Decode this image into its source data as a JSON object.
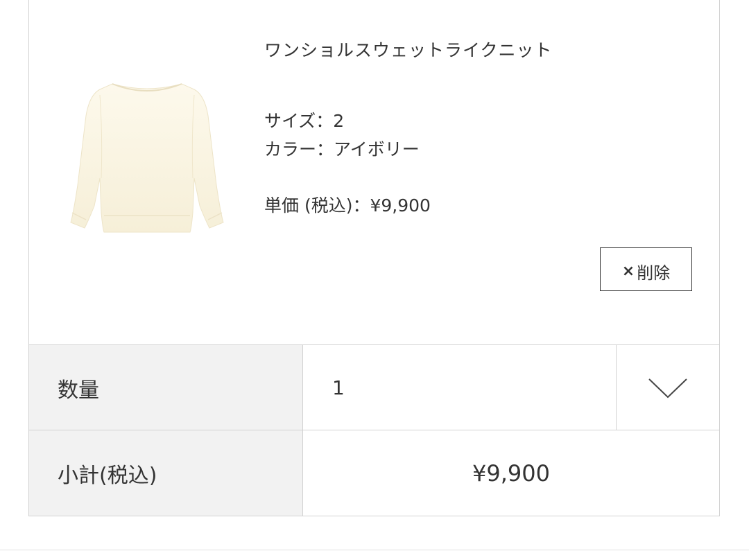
{
  "product": {
    "name": "ワンショルスウェットライクニット",
    "size_line": "サイズ：2",
    "color_line": "カラー：アイボリー",
    "price_line": "単価 (税込)：¥9,900",
    "image_icon": "sweater-image",
    "image_color": "#fbf6e6"
  },
  "actions": {
    "delete_label": "削除",
    "delete_icon": "close-icon",
    "delete_icon_glyph": "×"
  },
  "quantity": {
    "label": "数量",
    "value": "1",
    "dropdown_icon": "chevron-down-icon"
  },
  "subtotal": {
    "label": "小計(税込)",
    "value": "¥9,900"
  },
  "colors": {
    "border": "#d2d2d2",
    "label_background": "#f2f2f2",
    "text": "#333333"
  }
}
